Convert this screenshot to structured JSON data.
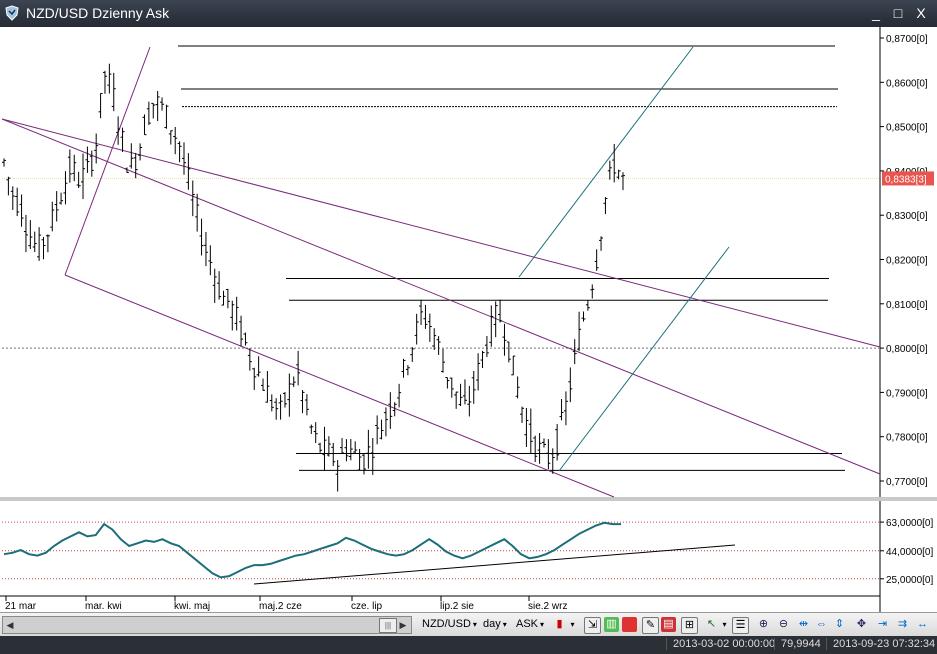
{
  "window": {
    "title": "NZD/USD Dzienny Ask",
    "minimize": "_",
    "maximize": "□",
    "close": "X"
  },
  "price_axis": {
    "labels": [
      "0,8700[0]",
      "0,8600[0]",
      "0,8500[0]",
      "0,8400[0]",
      "0,8300[0]",
      "0,8200[0]",
      "0,8100[0]",
      "0,8000[0]",
      "0,7900[0]",
      "0,7800[0]",
      "0,7700[0]"
    ],
    "current_price": "0,8383[3]"
  },
  "indicator_axis": {
    "labels": [
      "63,0000[0]",
      "44,0000[0]",
      "25,0000[0]"
    ]
  },
  "time_axis": {
    "labels": [
      "21 mar",
      "mar.",
      "kwi",
      "kwi.",
      "maj",
      "maj.2",
      "cze",
      "cze.",
      "lip",
      "lip.2",
      "sie",
      "sie.2",
      "wrz"
    ]
  },
  "toolbar": {
    "instrument": "NZD/USD",
    "period": "day",
    "side": "ASK",
    "arrow": "▾"
  },
  "status": {
    "start": "2013-03-02 00:00:00",
    "value": "79,9944",
    "end": "2013-09-23 07:32:34"
  },
  "chart_data": {
    "type": "ohlc",
    "instrument": "NZD/USD",
    "period": "day",
    "side": "Ask",
    "ylim": [
      0.769,
      0.874
    ],
    "x_ticks": [
      "21 mar",
      "mar.kwi",
      "kwi.maj",
      "maj.2 cze",
      "cze.lip",
      "lip.2 sie",
      "sie.2 wrz"
    ],
    "close_path": [
      0.842,
      0.835,
      0.832,
      0.826,
      0.822,
      0.825,
      0.83,
      0.836,
      0.841,
      0.838,
      0.84,
      0.846,
      0.862,
      0.858,
      0.848,
      0.84,
      0.844,
      0.852,
      0.856,
      0.854,
      0.85,
      0.846,
      0.838,
      0.83,
      0.823,
      0.818,
      0.812,
      0.81,
      0.806,
      0.8,
      0.796,
      0.792,
      0.788,
      0.785,
      0.79,
      0.795,
      0.787,
      0.78,
      0.777,
      0.776,
      0.774,
      0.778,
      0.776,
      0.775,
      0.778,
      0.782,
      0.786,
      0.79,
      0.796,
      0.802,
      0.808,
      0.805,
      0.8,
      0.794,
      0.79,
      0.786,
      0.79,
      0.797,
      0.803,
      0.808,
      0.804,
      0.794,
      0.786,
      0.78,
      0.777,
      0.775,
      0.778,
      0.785,
      0.795,
      0.805,
      0.812,
      0.822,
      0.835,
      0.842,
      0.838
    ],
    "horizontal_levels": [
      0.8682,
      0.8585,
      0.8545,
      0.8157,
      0.8108,
      0.7762,
      0.7724
    ],
    "current_price": 0.8383,
    "indicator": {
      "ylim": [
        20,
        80
      ],
      "levels": [
        63,
        44,
        25
      ],
      "values": [
        44,
        45,
        47,
        44,
        43,
        45,
        50,
        54,
        57,
        60,
        57,
        58,
        66,
        62,
        55,
        50,
        52,
        54,
        53,
        55,
        52,
        50,
        45,
        40,
        35,
        30,
        27,
        28,
        31,
        34,
        36,
        36,
        37,
        39,
        41,
        43,
        44,
        46,
        48,
        50,
        52,
        56,
        54,
        51,
        48,
        46,
        44,
        43,
        44,
        47,
        51,
        55,
        51,
        46,
        43,
        41,
        43,
        46,
        49,
        52,
        55,
        50,
        44,
        41,
        42,
        44,
        47,
        51,
        55,
        59,
        62,
        65,
        67,
        66,
        66
      ]
    }
  }
}
